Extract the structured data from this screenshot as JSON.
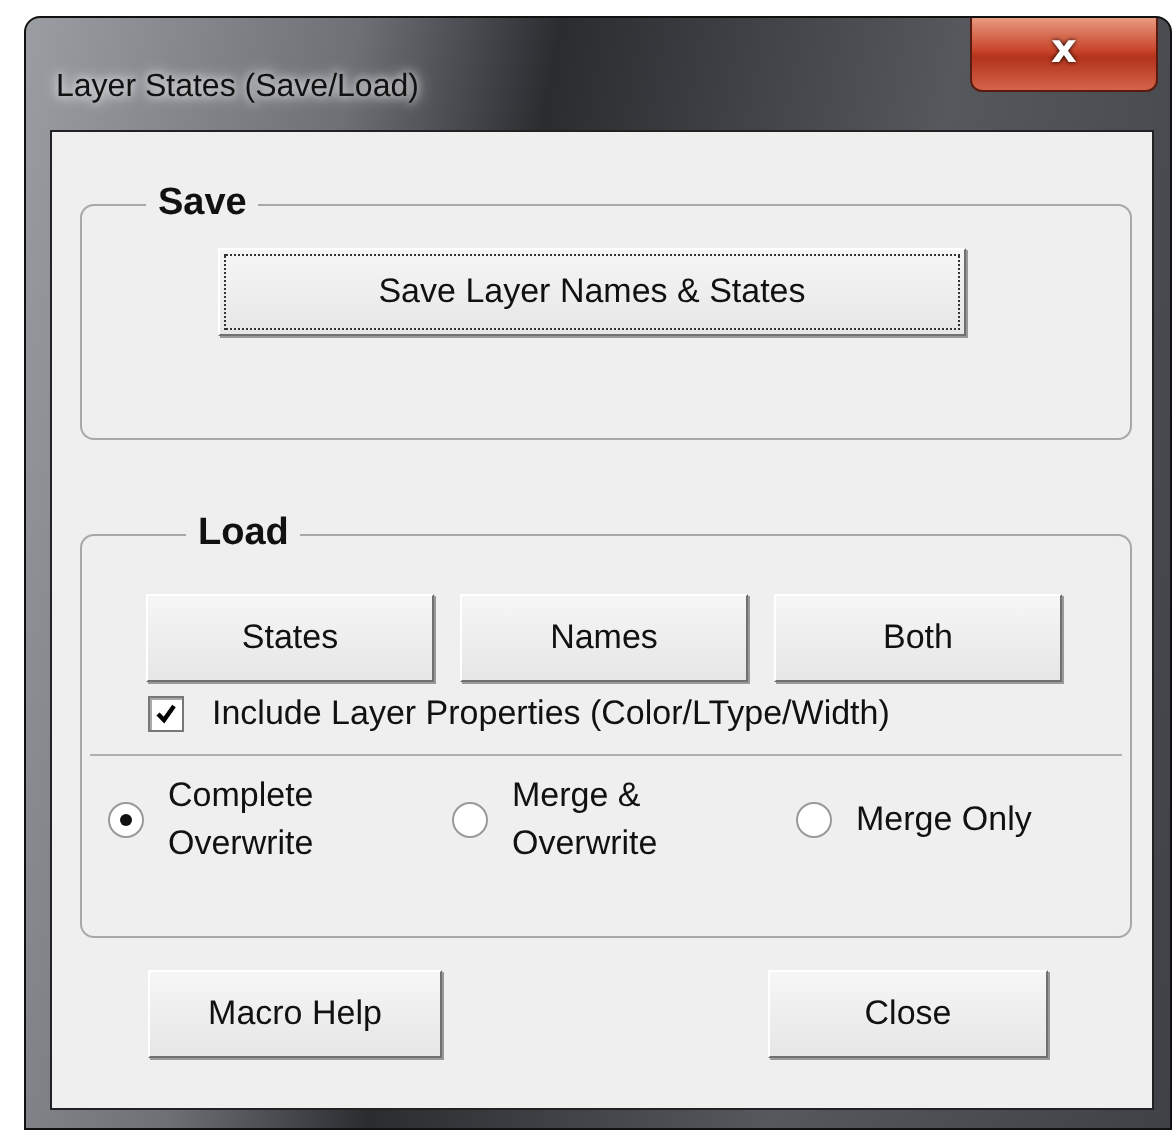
{
  "window": {
    "title": "Layer States (Save/Load)",
    "close_label": "x"
  },
  "save_group": {
    "legend": "Save",
    "button": "Save Layer Names & States"
  },
  "load_group": {
    "legend": "Load",
    "buttons": [
      "States",
      "Names",
      "Both"
    ],
    "checkbox": {
      "label": "Include Layer Properties (Color/LType/Width)",
      "checked": true
    },
    "options": [
      {
        "lines": [
          "Complete",
          "Overwrite"
        ],
        "selected": true
      },
      {
        "lines": [
          "Merge &",
          "Overwrite"
        ],
        "selected": false
      },
      {
        "lines": [
          "Merge Only"
        ],
        "selected": false
      }
    ]
  },
  "buttons": [
    "Macro Help",
    "Close"
  ]
}
